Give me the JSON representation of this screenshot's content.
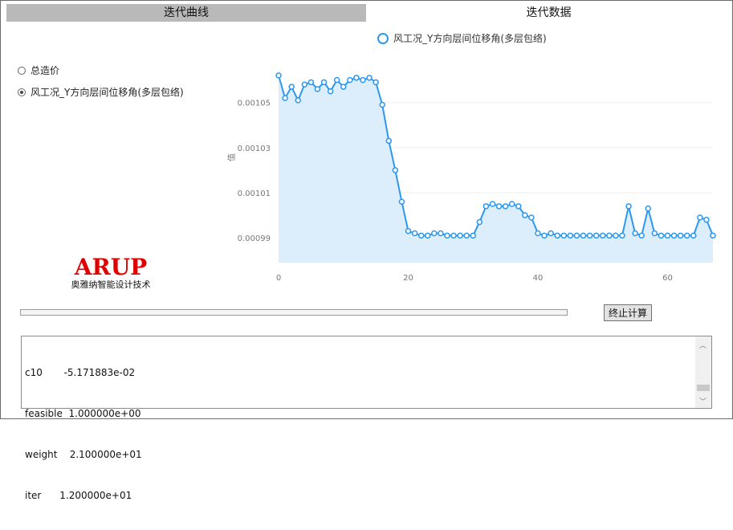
{
  "tabs": [
    {
      "label": "迭代曲线",
      "active": false
    },
    {
      "label": "迭代数据",
      "active": true
    }
  ],
  "radios": [
    {
      "label": "总造价",
      "checked": false
    },
    {
      "label": "风工况_Y方向层间位移角(多层包络)",
      "checked": true
    }
  ],
  "logo": {
    "main": "ARUP",
    "sub": "奥雅纳智能设计技术"
  },
  "progress": {
    "value": 0
  },
  "stop_button": {
    "label": "终止计算"
  },
  "log": {
    "lines": [
      "c10       -5.171883e-02",
      "feasible  1.000000e+00",
      "weight    2.100000e+01",
      "iter      1.200000e+01"
    ]
  },
  "colors": {
    "line": "#2d98f0",
    "area": "#dcedfb",
    "tab_inactive": "#b9b9b9",
    "logo": "#e00000"
  },
  "chart_data": {
    "type": "area",
    "legend": [
      "风工况_Y方向层间位移角(多层包络)"
    ],
    "legend_position": "top",
    "ylabel": "值",
    "xlabel": "",
    "xlim": [
      0,
      67
    ],
    "ylim": [
      0.000979,
      0.001067
    ],
    "xticks": [
      0,
      20,
      40,
      60
    ],
    "yticks": [
      0.00099,
      0.00101,
      0.00103,
      0.00105
    ],
    "ytick_labels": [
      "0.00099",
      "0.00101",
      "0.00103",
      "0.00105"
    ],
    "grid": "horizontal",
    "series": [
      {
        "name": "风工况_Y方向层间位移角(多层包络)",
        "x": [
          0,
          1,
          2,
          3,
          4,
          5,
          6,
          7,
          8,
          9,
          10,
          11,
          12,
          13,
          14,
          15,
          16,
          17,
          18,
          19,
          20,
          21,
          22,
          23,
          24,
          25,
          26,
          27,
          28,
          29,
          30,
          31,
          32,
          33,
          34,
          35,
          36,
          37,
          38,
          39,
          40,
          41,
          42,
          43,
          44,
          45,
          46,
          47,
          48,
          49,
          50,
          51,
          52,
          53,
          54,
          55,
          56,
          57,
          58,
          59,
          60,
          61,
          62,
          63,
          64,
          65,
          66,
          67
        ],
        "values": [
          0.001062,
          0.001052,
          0.001057,
          0.001051,
          0.001058,
          0.001059,
          0.001056,
          0.001059,
          0.001055,
          0.00106,
          0.001057,
          0.00106,
          0.001061,
          0.00106,
          0.001061,
          0.001059,
          0.001049,
          0.001033,
          0.00102,
          0.001006,
          0.000993,
          0.000992,
          0.000991,
          0.000991,
          0.000992,
          0.000992,
          0.000991,
          0.000991,
          0.000991,
          0.000991,
          0.000991,
          0.000997,
          0.001004,
          0.001005,
          0.001004,
          0.001004,
          0.001005,
          0.001004,
          0.001,
          0.000999,
          0.000992,
          0.000991,
          0.000992,
          0.000991,
          0.000991,
          0.000991,
          0.000991,
          0.000991,
          0.000991,
          0.000991,
          0.000991,
          0.000991,
          0.000991,
          0.000991,
          0.001004,
          0.000992,
          0.000991,
          0.001003,
          0.000992,
          0.000991,
          0.000991,
          0.000991,
          0.000991,
          0.000991,
          0.000991,
          0.000999,
          0.000998,
          0.000991
        ]
      }
    ]
  }
}
